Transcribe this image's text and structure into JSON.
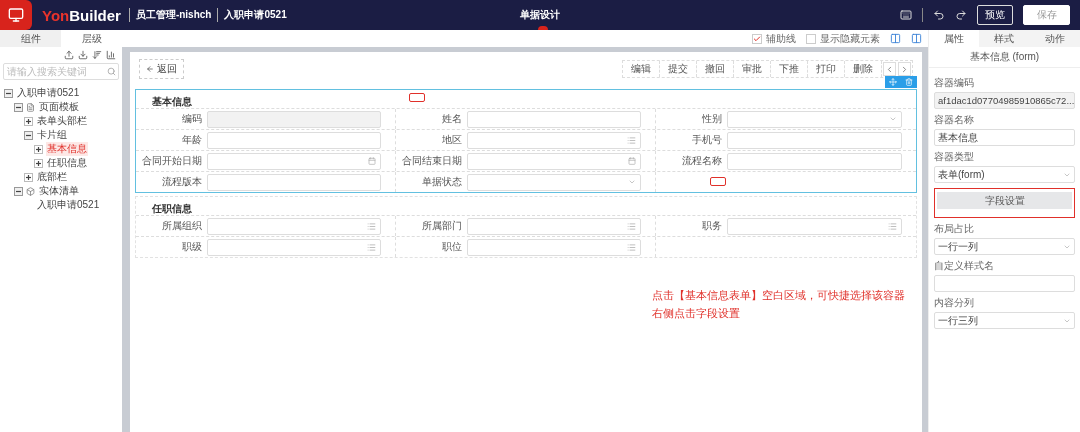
{
  "header": {
    "logo": {
      "accent": "Yon",
      "text": "Builder"
    },
    "breadcrumbs": [
      "员工管理-nishch",
      "入职申请0521"
    ],
    "title": "单据设计",
    "buttons": [
      {
        "label": "预览",
        "kind": "outline"
      },
      {
        "label": "保存",
        "kind": "solid"
      }
    ]
  },
  "left_panel": {
    "tabs": [
      {
        "label": "组件",
        "selected": false
      },
      {
        "label": "层级",
        "selected": true
      }
    ],
    "search": {
      "placeholder": "请输入搜索关键词"
    },
    "tree": [
      {
        "label": "入职申请0521",
        "expanded": true,
        "selected": false,
        "children": [
          {
            "label": "页面模板",
            "kind": "page",
            "expanded": true,
            "selected": false,
            "children": [
              {
                "label": "表单头部栏",
                "expanded": false,
                "selected": false
              },
              {
                "label": "卡片组",
                "expanded": true,
                "selected": false,
                "children": [
                  {
                    "label": "基本信息",
                    "expanded": false,
                    "selected": true
                  },
                  {
                    "label": "任职信息",
                    "expanded": false,
                    "selected": false
                  }
                ]
              },
              {
                "label": "底部栏",
                "expanded": false,
                "selected": false
              }
            ]
          },
          {
            "label": "实体清单",
            "kind": "entity",
            "expanded": true,
            "selected": false,
            "children": [
              {
                "label": "入职申请0521",
                "selected": false
              }
            ]
          }
        ]
      }
    ]
  },
  "canvas": {
    "options": [
      {
        "label": "辅助线",
        "checked": true
      },
      {
        "label": "显示隐藏元素",
        "checked": false
      }
    ],
    "back_button": "返回",
    "actions": [
      "编辑",
      "提交",
      "撤回",
      "审批",
      "下推",
      "打印",
      "删除"
    ]
  },
  "form": {
    "sections": [
      {
        "title": "基本信息",
        "selected": true,
        "rows": [
          [
            {
              "label": "编码",
              "kind": "disabled"
            },
            {
              "label": "姓名",
              "kind": "text"
            },
            {
              "label": "性别",
              "kind": "select"
            }
          ],
          [
            {
              "label": "年龄",
              "kind": "text"
            },
            {
              "label": "地区",
              "kind": "list"
            },
            {
              "label": "手机号",
              "kind": "text"
            }
          ],
          [
            {
              "label": "合同开始日期",
              "kind": "date"
            },
            {
              "label": "合同结束日期",
              "kind": "date"
            },
            {
              "label": "流程名称",
              "kind": "text"
            }
          ],
          [
            {
              "label": "流程版本",
              "kind": "text"
            },
            {
              "label": "单据状态",
              "kind": "select"
            }
          ]
        ]
      },
      {
        "title": "任职信息",
        "selected": false,
        "rows": [
          [
            {
              "label": "所属组织",
              "kind": "list"
            },
            {
              "label": "所属部门",
              "kind": "list"
            },
            {
              "label": "职务",
              "kind": "list"
            }
          ],
          [
            {
              "label": "职级",
              "kind": "list"
            },
            {
              "label": "职位",
              "kind": "list"
            }
          ]
        ]
      }
    ]
  },
  "annotation": [
    "点击【基本信息表单】空白区域，可快捷选择该容器",
    "右侧点击字段设置"
  ],
  "right_panel": {
    "tabs": [
      {
        "label": "属性",
        "selected": true
      },
      {
        "label": "样式",
        "selected": false
      },
      {
        "label": "动作",
        "selected": false
      }
    ],
    "title": "基本信息 (form)",
    "properties": [
      {
        "label": "容器编码",
        "kind": "disabled",
        "value": "af1dac1d07704985910865c72..."
      },
      {
        "label": "容器名称",
        "kind": "input",
        "value": "基本信息"
      },
      {
        "label": "容器类型",
        "kind": "select",
        "value": "表单(form)"
      },
      {
        "kind": "button",
        "value": "字段设置",
        "highlighted": true
      },
      {
        "label": "布局占比",
        "kind": "select",
        "value": "一行一列"
      },
      {
        "label": "自定义样式名",
        "kind": "input"
      },
      {
        "label": "内容分列",
        "kind": "select",
        "value": "一行三列"
      }
    ]
  }
}
